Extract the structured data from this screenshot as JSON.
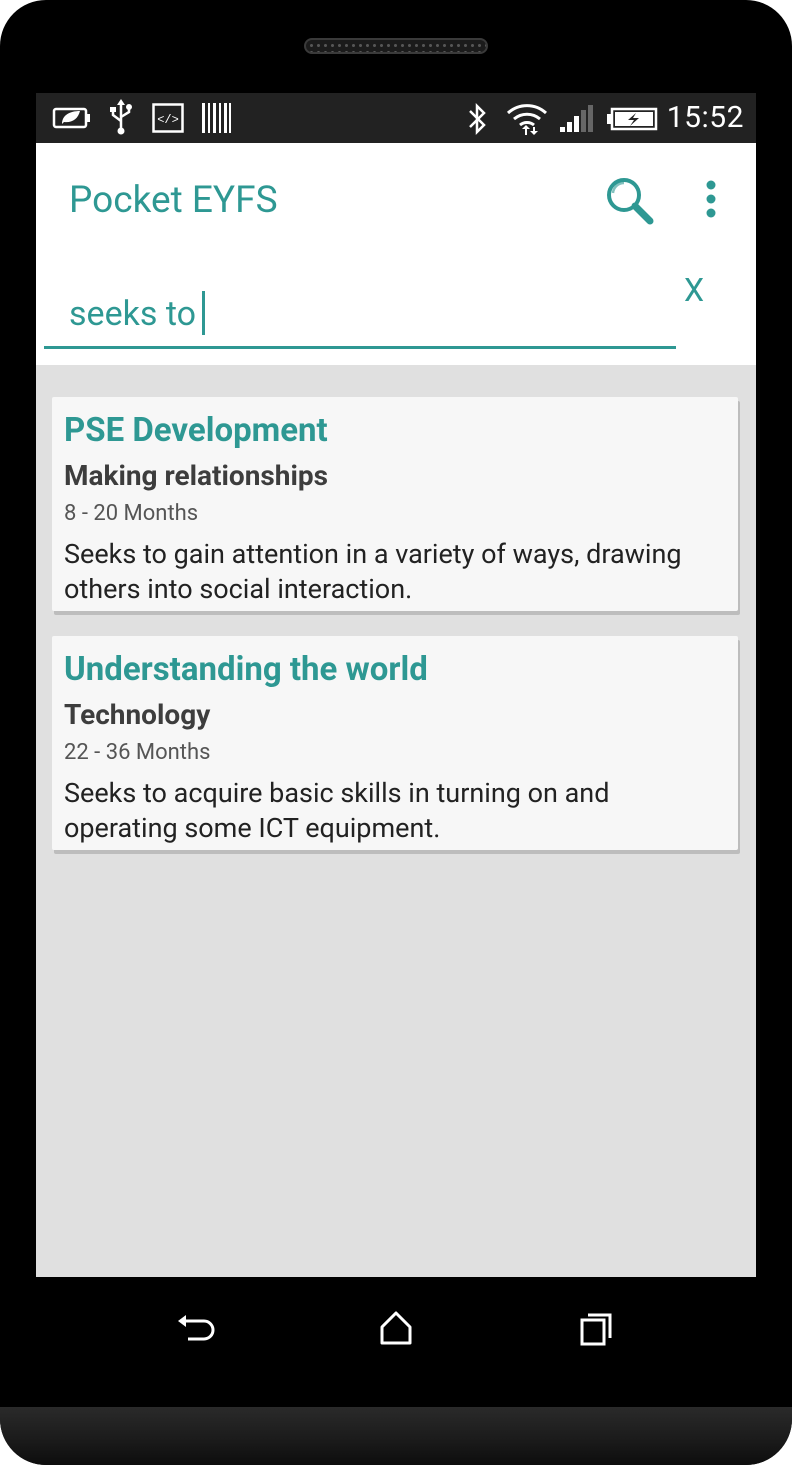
{
  "status_bar": {
    "time": "15:52",
    "icons": [
      "leaf-battery-saver-icon",
      "usb-icon",
      "developer-code-icon",
      "barcode-icon",
      "bluetooth-icon",
      "wifi-icon",
      "cell-signal-icon",
      "battery-charging-icon"
    ]
  },
  "app_bar": {
    "title": "Pocket EYFS",
    "search_icon": "search-icon",
    "menu_icon": "more-vert-icon"
  },
  "search": {
    "query": "seeks to",
    "clear_label": "X"
  },
  "results": [
    {
      "area": "PSE Development",
      "aspect": "Making relationships",
      "age": "8 - 20 Months",
      "description": "Seeks to gain attention in a variety of ways, drawing others into social interaction."
    },
    {
      "area": "Understanding the world",
      "aspect": "Technology",
      "age": "22 - 36 Months",
      "description": "Seeks to acquire basic skills in turning on and operating some ICT equipment."
    }
  ],
  "nav_bar": {
    "icons": [
      "back-icon",
      "home-icon",
      "recents-icon"
    ]
  },
  "colors": {
    "accent": "#2e9893",
    "status_bar": "#222222",
    "screen_background": "#e0e0e0",
    "card_background": "#f7f7f7"
  }
}
